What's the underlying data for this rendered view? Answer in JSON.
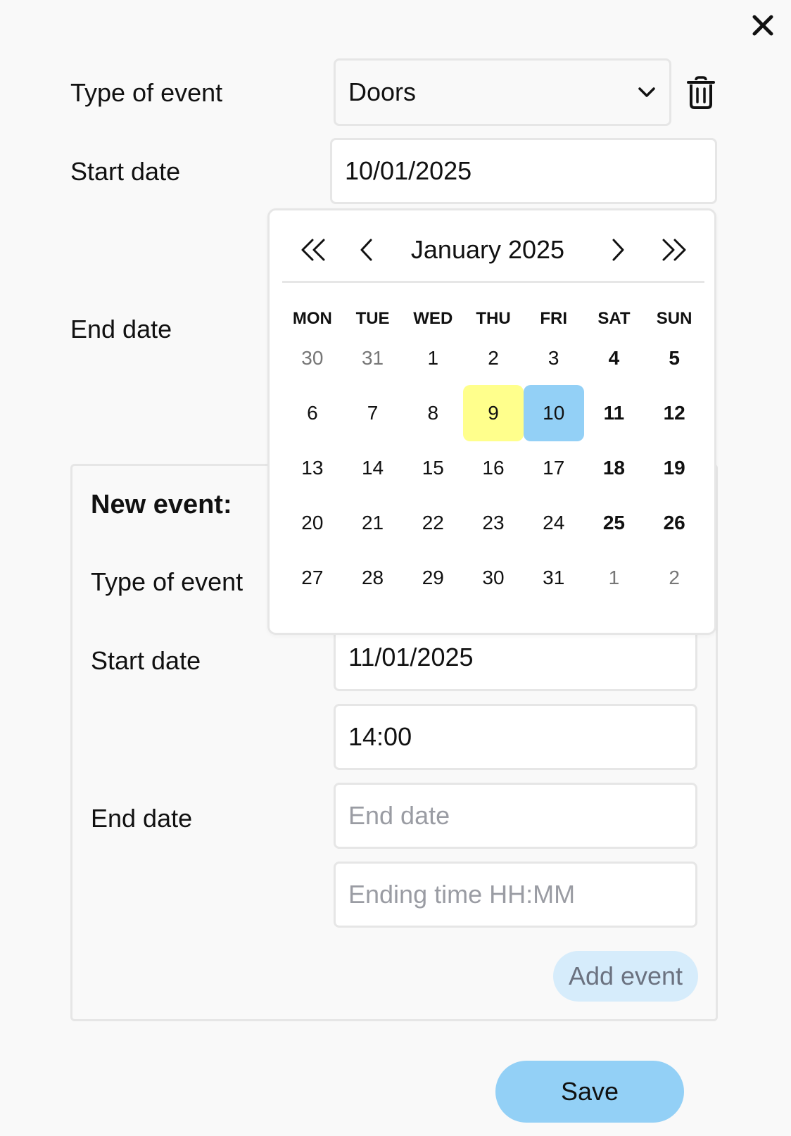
{
  "colors": {
    "background": "#f9f9f9",
    "today_highlight": "#ffff8c",
    "selected_highlight": "#93d0f6",
    "save_button": "#93d0f6",
    "add_button": "#d6ecfb"
  },
  "icons": {
    "close": "close-icon",
    "trash": "trash-icon",
    "chevron": "chevron-down-icon",
    "prev_year": "double-chevron-left-icon",
    "prev_month": "chevron-left-icon",
    "next_month": "chevron-right-icon",
    "next_year": "double-chevron-right-icon"
  },
  "event": {
    "type_label": "Type of event",
    "type_value": "Doors",
    "start_label": "Start date",
    "start_value": "10/01/2025",
    "end_label": "End date"
  },
  "calendar": {
    "month_label": "January 2025",
    "weekdays": [
      "MON",
      "TUE",
      "WED",
      "THU",
      "FRI",
      "SAT",
      "SUN"
    ],
    "weeks": [
      [
        {
          "d": "30",
          "o": true
        },
        {
          "d": "31",
          "o": true
        },
        {
          "d": "1"
        },
        {
          "d": "2"
        },
        {
          "d": "3"
        },
        {
          "d": "4"
        },
        {
          "d": "5"
        }
      ],
      [
        {
          "d": "6"
        },
        {
          "d": "7"
        },
        {
          "d": "8"
        },
        {
          "d": "9",
          "today": true
        },
        {
          "d": "10",
          "selected": true
        },
        {
          "d": "11"
        },
        {
          "d": "12"
        }
      ],
      [
        {
          "d": "13"
        },
        {
          "d": "14"
        },
        {
          "d": "15"
        },
        {
          "d": "16"
        },
        {
          "d": "17"
        },
        {
          "d": "18"
        },
        {
          "d": "19"
        }
      ],
      [
        {
          "d": "20"
        },
        {
          "d": "21"
        },
        {
          "d": "22"
        },
        {
          "d": "23"
        },
        {
          "d": "24"
        },
        {
          "d": "25"
        },
        {
          "d": "26"
        }
      ],
      [
        {
          "d": "27"
        },
        {
          "d": "28"
        },
        {
          "d": "29"
        },
        {
          "d": "30"
        },
        {
          "d": "31"
        },
        {
          "d": "1",
          "o": true
        },
        {
          "d": "2",
          "o": true
        }
      ]
    ]
  },
  "new_event": {
    "title": "New event:",
    "type_label": "Type of event",
    "start_label": "Start date",
    "start_value": "11/01/2025",
    "start_time": "14:00",
    "end_label": "End date",
    "end_date_placeholder": "End date",
    "end_time_placeholder": "Ending time HH:MM",
    "add_label": "Add event"
  },
  "save_label": "Save"
}
